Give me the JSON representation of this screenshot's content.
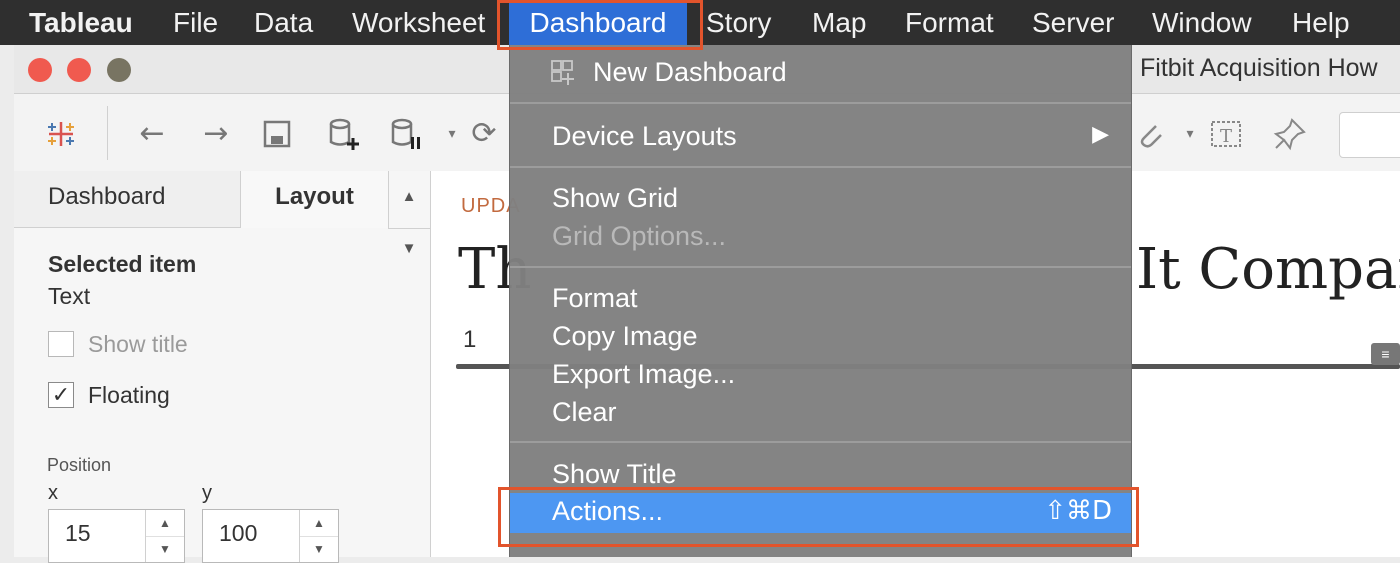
{
  "menubar": {
    "app": "Tableau",
    "items": [
      "File",
      "Data",
      "Worksheet",
      "Dashboard",
      "Story",
      "Map",
      "Format",
      "Server",
      "Window",
      "Help"
    ],
    "active": "Dashboard"
  },
  "window": {
    "title": "Fitbit Acquisition How"
  },
  "left_panel": {
    "tabs": [
      "Dashboard",
      "Layout"
    ],
    "active_tab": "Layout",
    "selected_heading": "Selected item",
    "selected_value": "Text",
    "show_title_label": "Show title",
    "show_title_checked": false,
    "floating_label": "Floating",
    "floating_checked": true,
    "floating_mark": "✓",
    "position_label": "Position",
    "x_label": "x",
    "y_label": "y",
    "x_value": "15",
    "y_value": "100"
  },
  "canvas": {
    "label": "UPDA",
    "title_left": "Th",
    "title_right": "It Compare",
    "number": "1"
  },
  "dashboard_menu": {
    "new_dashboard": "New Dashboard",
    "device_layouts": "Device Layouts",
    "show_grid": "Show Grid",
    "grid_options": "Grid Options...",
    "format": "Format",
    "copy_image": "Copy Image",
    "export_image": "Export Image...",
    "clear": "Clear",
    "show_title": "Show Title",
    "actions": "Actions...",
    "actions_shortcut": "⇧⌘D",
    "submenu_arrow": "▶"
  },
  "colors": {
    "menubar_bg": "#2f2f2f",
    "menu_active": "#2e6ed7",
    "menu_bg": "#808080",
    "selected_item": "#4d97f2",
    "highlight_box": "#e2542c",
    "canvas_label": "#c26a3f"
  },
  "icons": [
    "tableau-logo-icon",
    "back-arrow-icon",
    "forward-arrow-icon",
    "save-icon",
    "new-datasource-icon",
    "pause-datasource-icon",
    "refresh-icon",
    "paperclip-icon",
    "text-box-icon",
    "pin-icon",
    "add-grid-icon",
    "chevron-right-icon"
  ]
}
